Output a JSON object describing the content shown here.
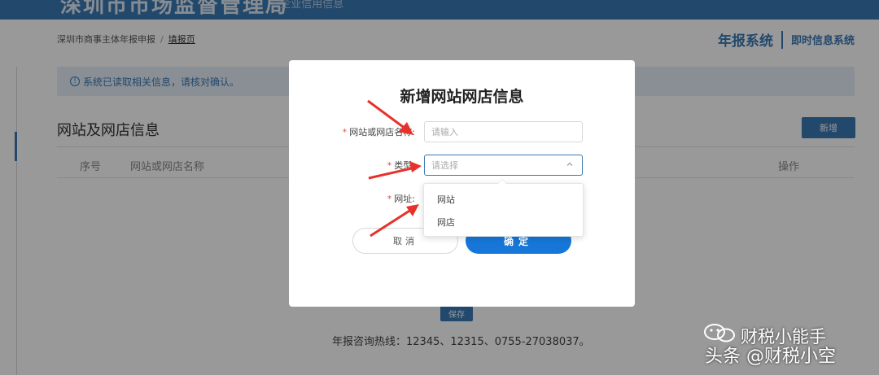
{
  "header": {
    "brand": "深圳市市场监督管理局",
    "brand_sub": "· 企业信用信息"
  },
  "breadcrumb": {
    "parent": "深圳市商事主体年报申报",
    "separator": "/",
    "current": "填报页"
  },
  "system_switch": {
    "primary": "年报系统",
    "secondary": "即时信息系统"
  },
  "info_bar": {
    "icon": "info-circle-icon",
    "icon_glyph": "!",
    "text": "系统已读取相关信息，请核对确认。"
  },
  "section": {
    "title": "网站及网店信息",
    "add_label": "新增"
  },
  "table": {
    "columns": [
      "序号",
      "网站或网店名称",
      "操作"
    ]
  },
  "footer": {
    "save_label": "保存",
    "hotline": "年报咨询热线：12345、12315、0755-27038037。"
  },
  "modal": {
    "title": "新增网站网店信息",
    "required_mark": "*",
    "fields": [
      {
        "label": "网站或网店名称:",
        "placeholder": "请输入"
      },
      {
        "label": "类型:",
        "placeholder": "请选择"
      },
      {
        "label": "网址:",
        "placeholder": ""
      }
    ],
    "cancel_label": "取消",
    "ok_label": "确定"
  },
  "dropdown": {
    "options": [
      "网站",
      "网店"
    ]
  },
  "watermark": {
    "line1": "财税小能手",
    "line2": "头条 @财税小空"
  },
  "colors": {
    "brand_blue": "#3a78b4",
    "primary_button": "#1677d8",
    "required_red": "#e64b3c",
    "annotation_arrow": "#e8312a"
  }
}
